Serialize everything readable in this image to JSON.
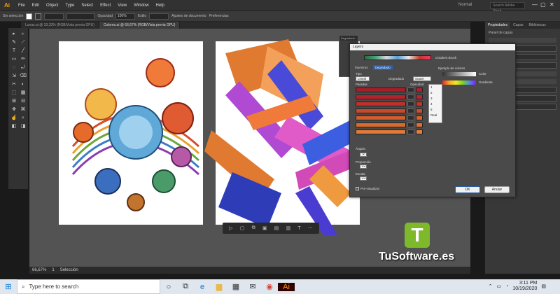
{
  "app": {
    "logo": "Ai",
    "menus": [
      "File",
      "Edit",
      "Object",
      "Type",
      "Select",
      "Effect",
      "View",
      "Window",
      "Help"
    ],
    "workspace": "Normal",
    "search_placeholder": "Search Adobe Stock"
  },
  "control_bar": {
    "selection_label": "Sin selección",
    "opacity_label": "Opacidad",
    "opacity_value": "100%",
    "style_label": "Estilo",
    "doc_settings": "Ajustes de documento",
    "prefs": "Preferencias"
  },
  "tabs": [
    {
      "label": "Lunas.ai @ 33,33% (RGB/Vista previa GPU)",
      "active": false
    },
    {
      "label": "Colores.ai @ 66,67% (RGB/Vista previa GPU)",
      "active": true
    }
  ],
  "tools": [
    "▸",
    "▹",
    "✎",
    "⟋",
    "T",
    "╱",
    "▭",
    "✏",
    "◌",
    "⤾",
    "⇲",
    "⌫",
    "✂",
    "◐",
    "⬚",
    "▦",
    "⊞",
    "⊟",
    "✥",
    "⌘",
    "☝",
    "⌕",
    "◧",
    "◨"
  ],
  "status": {
    "zoom": "66,67%",
    "page": "1",
    "mode": "Selección"
  },
  "right_panel": {
    "tabs": [
      "Propiedades",
      "Capas",
      "Bibliotecas"
    ],
    "section": "Panel de capas",
    "items": [
      "Minimizar",
      "Minimizar",
      "Minimizar",
      "Ajustar trazos",
      "Redibujar",
      "Reordenar"
    ]
  },
  "gradient_panel": {
    "title": "Degradado"
  },
  "dialog": {
    "title": "Layers",
    "brush_label": "Gradient Brush",
    "tabs": [
      "Muestras",
      "Degradado"
    ],
    "type_label": "Tipo",
    "type_value": "Lineal",
    "gradient_label": "Degradado",
    "gradient_value": "Suave",
    "stops_header": "Paradas",
    "opacity_header": "Opacidad",
    "stops": [
      {
        "color": "#a61e2a",
        "swatch": "#b0202c"
      },
      {
        "color": "#b4232b",
        "swatch": "#bb2530"
      },
      {
        "color": "#c0302a",
        "swatch": "#c53327"
      },
      {
        "color": "#c84a2b",
        "swatch": "#ce4d2c"
      },
      {
        "color": "#d25d2d",
        "swatch": "#d8612e"
      },
      {
        "color": "#d86a30",
        "swatch": "#dd6f33"
      },
      {
        "color": "#e07a36",
        "swatch": "#e47f38"
      }
    ],
    "angle_label": "Ángulo",
    "angle_value": "-90",
    "ratio_label": "Proporción",
    "ratio_value": "100",
    "scale_label": "Escala",
    "scale_value": "100",
    "ok_label": "OK",
    "cancel_label": "Anular",
    "preview_label": "Pre-visualizar",
    "color_label": "Color",
    "gradient_sample_label": "Gradiente",
    "sample_header": "Ejemplo de colores"
  },
  "dropdown": {
    "items": [
      "1",
      "2",
      "3",
      "4",
      "5",
      "Real"
    ]
  },
  "watermark": {
    "badge": "T",
    "site": "TuSoftware.es"
  },
  "taskbar": {
    "search_placeholder": "Type here to search",
    "time": "3:11 PM",
    "date": "10/19/2020"
  }
}
